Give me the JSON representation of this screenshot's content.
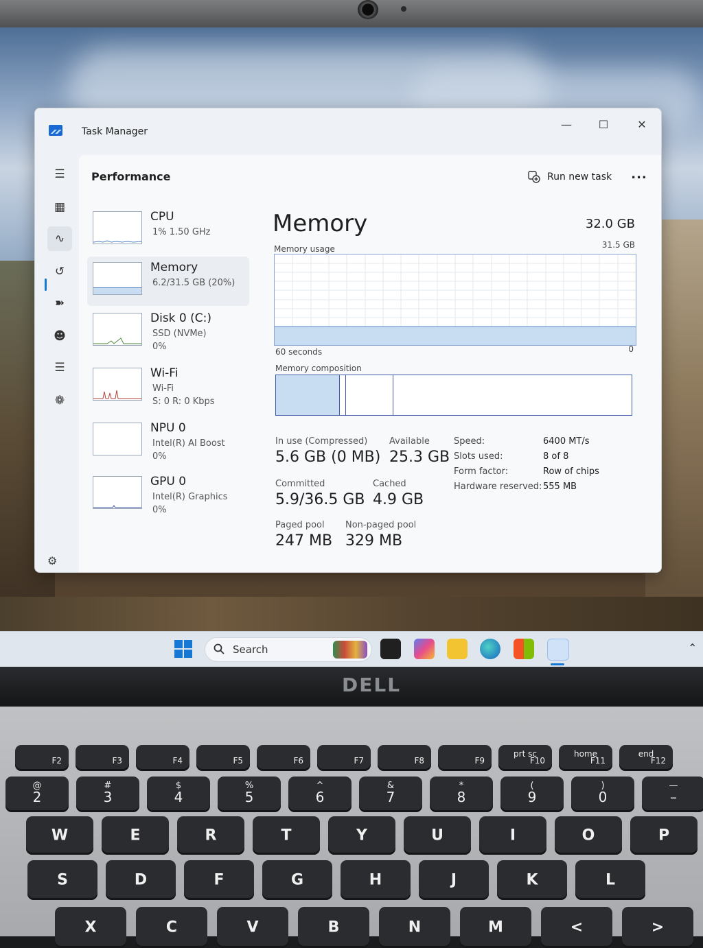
{
  "window": {
    "title": "Task Manager"
  },
  "header": {
    "title": "Performance",
    "run_new_task": "Run new task",
    "more": "..."
  },
  "devices": [
    {
      "name": "CPU",
      "line1": "1%  1.50 GHz",
      "line2": ""
    },
    {
      "name": "Memory",
      "line1": "6.2/31.5 GB (20%)",
      "line2": ""
    },
    {
      "name": "Disk 0 (C:)",
      "line1": "SSD (NVMe)",
      "line2": "0%"
    },
    {
      "name": "Wi-Fi",
      "line1": "Wi-Fi",
      "line2": "S: 0  R: 0 Kbps"
    },
    {
      "name": "NPU 0",
      "line1": "Intel(R) AI Boost",
      "line2": "0%"
    },
    {
      "name": "GPU 0",
      "line1": "Intel(R) Graphics",
      "line2": "0%"
    }
  ],
  "memory": {
    "heading": "Memory",
    "total": "32.0 GB",
    "usage_label": "Memory usage",
    "usage_max": "31.5 GB",
    "axis_left": "60 seconds",
    "axis_right": "0",
    "usage_fraction": 0.197,
    "composition_label": "Memory composition",
    "composition_fractions": [
      0.18,
      0.016,
      0.135,
      0.669
    ],
    "stats": {
      "in_use_label": "In use (Compressed)",
      "in_use_value": "5.6 GB (0 MB)",
      "available_label": "Available",
      "available_value": "25.3 GB",
      "committed_label": "Committed",
      "committed_value": "5.9/36.5 GB",
      "cached_label": "Cached",
      "cached_value": "4.9 GB",
      "paged_label": "Paged pool",
      "paged_value": "247 MB",
      "nonpaged_label": "Non-paged pool",
      "nonpaged_value": "329 MB"
    },
    "details": [
      {
        "key": "Speed:",
        "value": "6400 MT/s"
      },
      {
        "key": "Slots used:",
        "value": "8 of 8"
      },
      {
        "key": "Form factor:",
        "value": "Row of chips"
      },
      {
        "key": "Hardware reserved:",
        "value": "555 MB"
      }
    ]
  },
  "taskbar": {
    "search_placeholder": "Search"
  },
  "brand": "DELL",
  "keyboard": {
    "fn_row": [
      {
        "top": "",
        "sub": "F2"
      },
      {
        "top": "",
        "sub": "F3"
      },
      {
        "top": "",
        "sub": "F4"
      },
      {
        "top": "",
        "sub": "F5"
      },
      {
        "top": "",
        "sub": "F6"
      },
      {
        "top": "",
        "sub": "F7"
      },
      {
        "top": "",
        "sub": "F8"
      },
      {
        "top": "",
        "sub": "F9"
      },
      {
        "top": "prt sc",
        "sub": "F10"
      },
      {
        "top": "home",
        "sub": "F11"
      },
      {
        "top": "end",
        "sub": "F12"
      }
    ],
    "num_row": [
      {
        "top": "@",
        "main": "2"
      },
      {
        "top": "#",
        "main": "3"
      },
      {
        "top": "$",
        "main": "4"
      },
      {
        "top": "%",
        "main": "5"
      },
      {
        "top": "^",
        "main": "6"
      },
      {
        "top": "&",
        "main": "7"
      },
      {
        "top": "*",
        "main": "8"
      },
      {
        "top": "(",
        "main": "9"
      },
      {
        "top": ")",
        "main": "0"
      },
      {
        "top": "—",
        "main": "–"
      }
    ],
    "row_q": [
      "W",
      "E",
      "R",
      "T",
      "Y",
      "U",
      "I",
      "O",
      "P"
    ],
    "row_a": [
      "S",
      "D",
      "F",
      "G",
      "H",
      "J",
      "K",
      "L"
    ],
    "row_z": [
      "X",
      "C",
      "V",
      "B",
      "N",
      "M",
      "<",
      ">"
    ]
  },
  "colors": {
    "accent": "#1677d4",
    "chart_border": "#8aa4cf",
    "chart_fill": "#c8dcf2",
    "composition_border": "#4157a9"
  }
}
